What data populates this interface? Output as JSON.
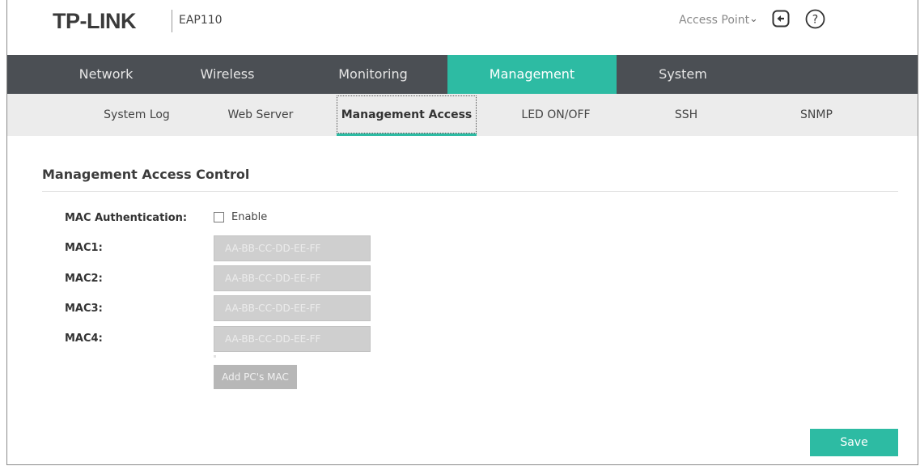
{
  "header": {
    "logo": "TP-LINK",
    "model": "EAP110",
    "mode": "Access Point",
    "logout_icon": "logout-icon",
    "help_icon": "help-icon"
  },
  "main_nav": {
    "tabs": [
      "Network",
      "Wireless",
      "Monitoring",
      "Management",
      "System"
    ],
    "active": "Management"
  },
  "sub_nav": {
    "tabs": [
      "System Log",
      "Web Server",
      "Management Access",
      "LED ON/OFF",
      "SSH",
      "SNMP"
    ],
    "active": "Management Access"
  },
  "content": {
    "title": "Management Access Control",
    "mac_auth_label": "MAC Authentication:",
    "enable_label": "Enable",
    "enable_checked": false,
    "mac_fields": [
      {
        "label": "MAC1:",
        "value": "",
        "placeholder": "AA-BB-CC-DD-EE-FF"
      },
      {
        "label": "MAC2:",
        "value": "",
        "placeholder": "AA-BB-CC-DD-EE-FF"
      },
      {
        "label": "MAC3:",
        "value": "",
        "placeholder": "AA-BB-CC-DD-EE-FF"
      },
      {
        "label": "MAC4:",
        "value": "",
        "placeholder": "AA-BB-CC-DD-EE-FF"
      }
    ],
    "add_mac_label": "Add PC's MAC",
    "save_label": "Save"
  },
  "colors": {
    "accent": "#2dbba3",
    "nav_bg": "#4b4f54",
    "subnav_bg": "#ececec",
    "input_disabled": "#cfcfcf"
  }
}
